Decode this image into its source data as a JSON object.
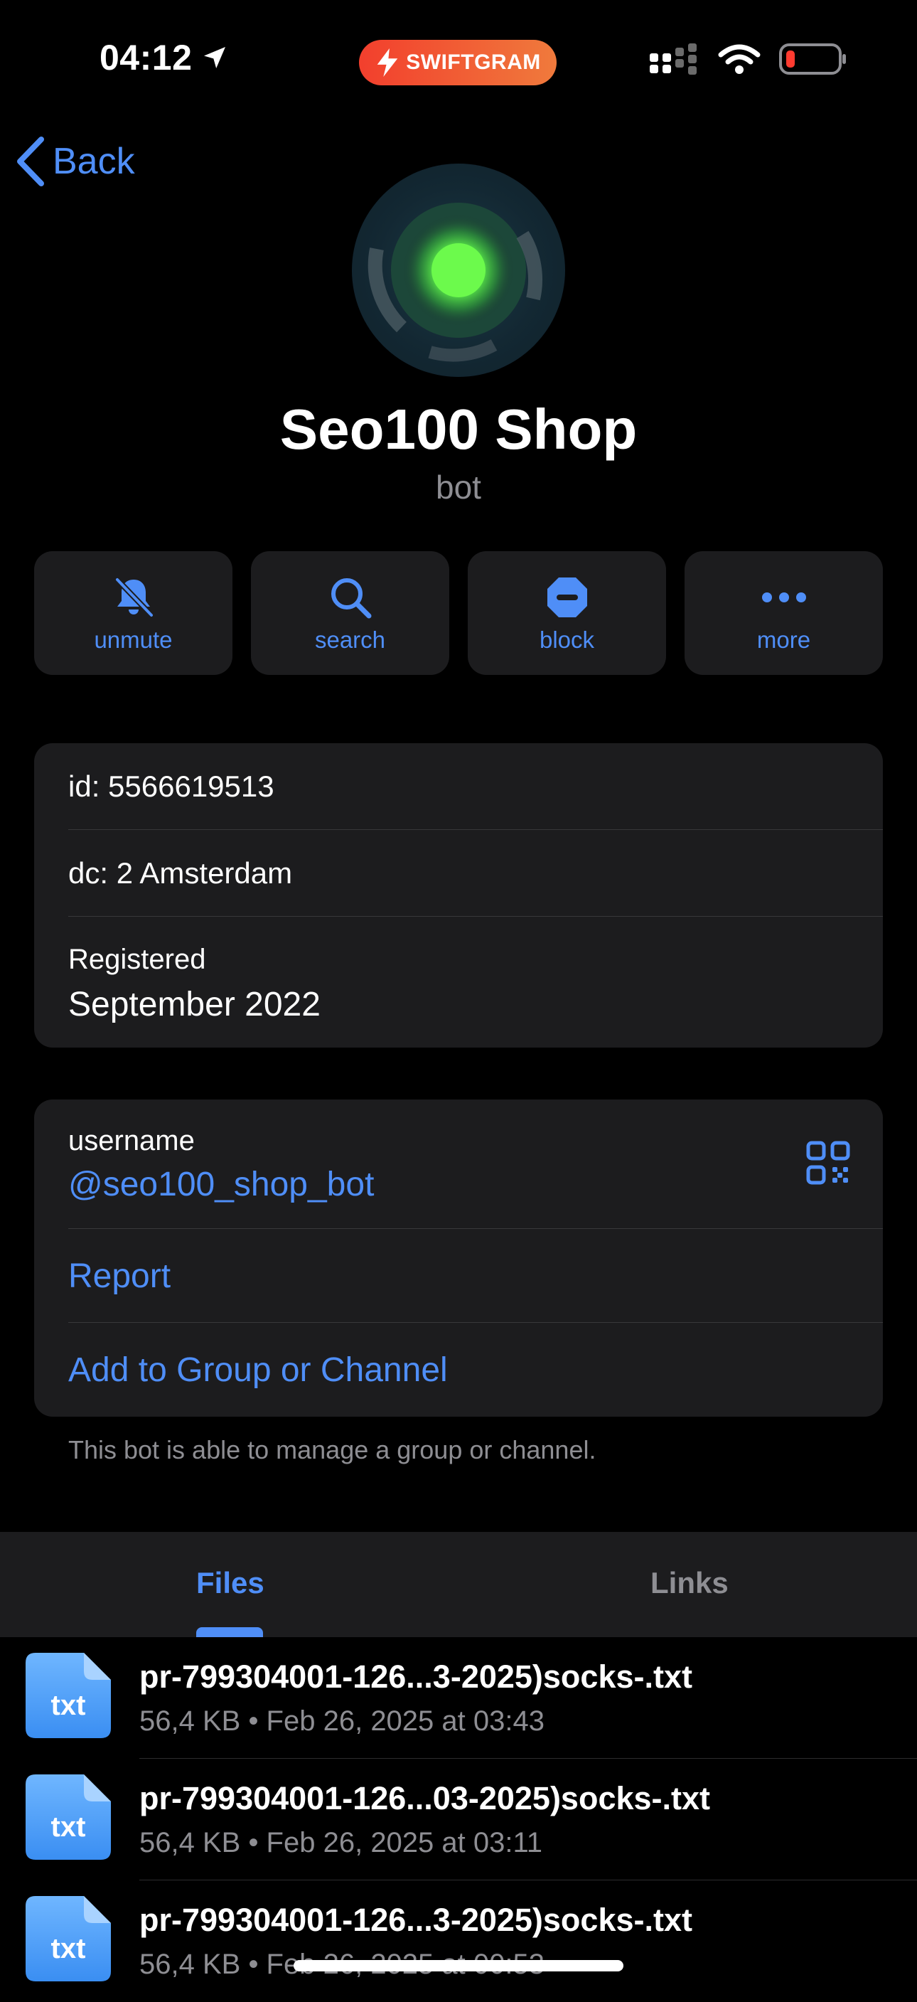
{
  "status_bar": {
    "time": "04:12",
    "badge": "SWIFTGRAM",
    "icons": [
      "location-arrow-icon",
      "cellular-signal-icon",
      "wifi-icon",
      "battery-low-icon"
    ]
  },
  "nav": {
    "back_label": "Back"
  },
  "profile": {
    "name": "Seo100 Shop",
    "subtitle": "bot"
  },
  "actions": [
    {
      "label": "unmute",
      "icon": "bell-slash-icon"
    },
    {
      "label": "search",
      "icon": "search-icon"
    },
    {
      "label": "block",
      "icon": "block-icon"
    },
    {
      "label": "more",
      "icon": "ellipsis-icon"
    }
  ],
  "info": {
    "id": "id: 5566619513",
    "dc": "dc: 2 Amsterdam",
    "registered_label": "Registered",
    "registered_value": "September 2022"
  },
  "links": {
    "username_label": "username",
    "username_value": "@seo100_shop_bot",
    "report": "Report",
    "add_to_group": "Add to Group or Channel",
    "note": "This bot is able to manage a group or channel."
  },
  "tabs": [
    {
      "label": "Files",
      "active": true
    },
    {
      "label": "Links",
      "active": false
    }
  ],
  "files": [
    {
      "ext": "txt",
      "name": "pr-799304001-126...3-2025)socks-.txt",
      "meta": "56,4 KB • Feb 26, 2025 at 03:43"
    },
    {
      "ext": "txt",
      "name": "pr-799304001-126...03-2025)socks-.txt",
      "meta": "56,4 KB • Feb 26, 2025 at 03:11"
    },
    {
      "ext": "txt",
      "name": "pr-799304001-126...3-2025)socks-.txt",
      "meta": "56,4 KB • Feb 26, 2025 at 00:53"
    }
  ],
  "colors": {
    "accent": "#4f8ef7",
    "background": "#000000",
    "card": "#1c1c1e",
    "secondary_text": "#8e8e93",
    "swiftgram_badge": "#f04a32",
    "avatar_glow": "#5cf04a"
  }
}
